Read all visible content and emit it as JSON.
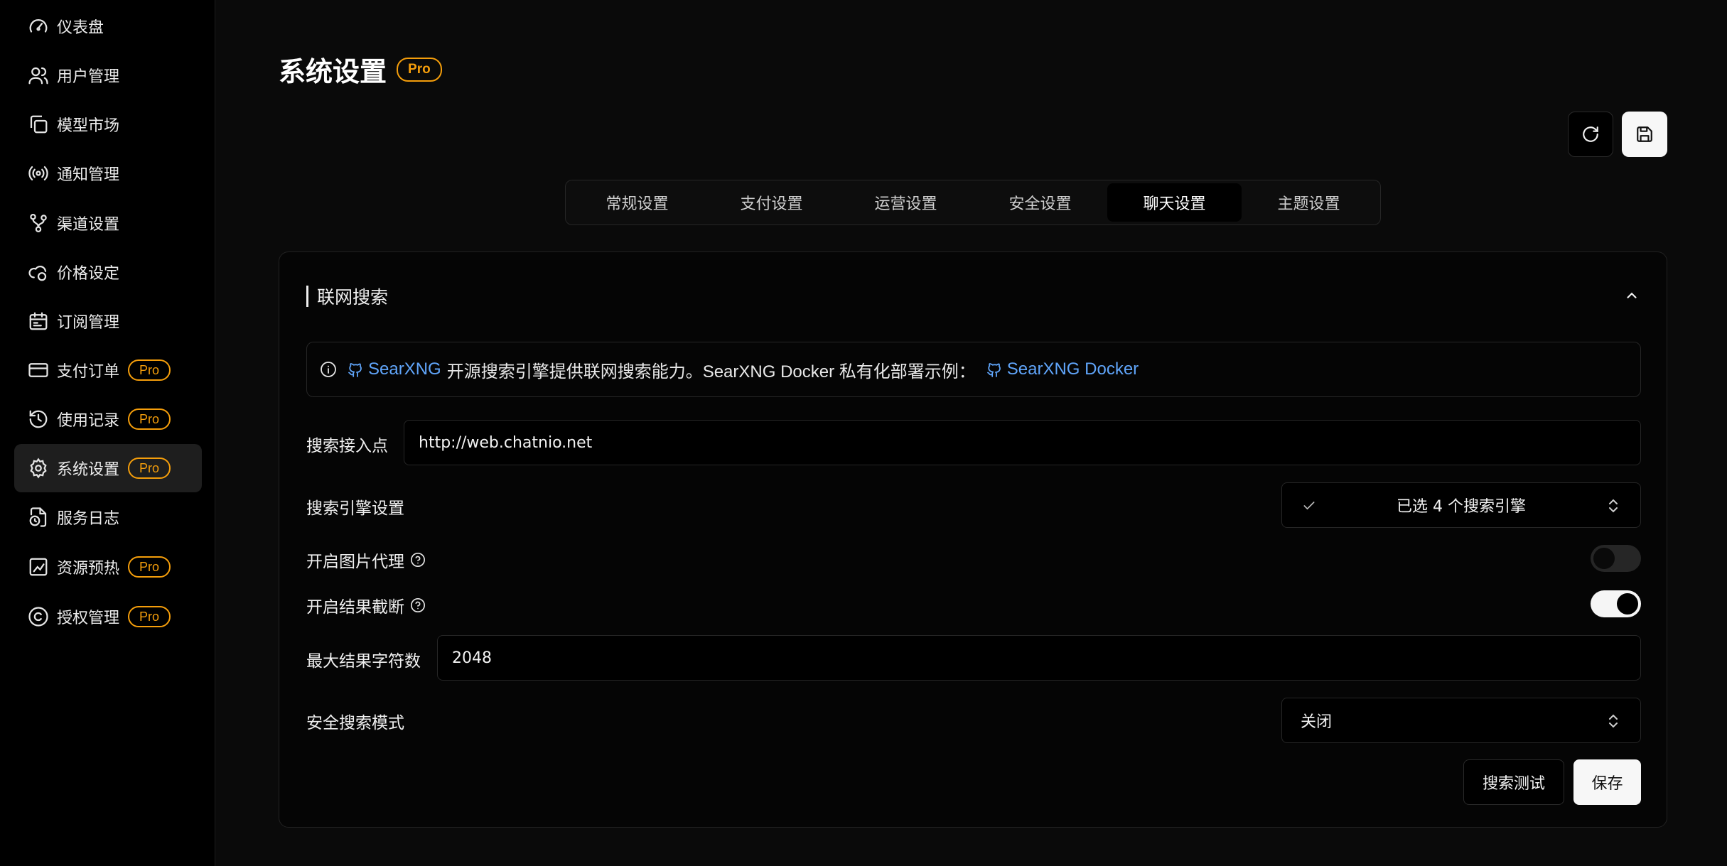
{
  "sidebar": {
    "items": [
      {
        "label": "仪表盘",
        "icon": "gauge-icon",
        "pro": ""
      },
      {
        "label": "用户管理",
        "icon": "users-icon",
        "pro": ""
      },
      {
        "label": "模型市场",
        "icon": "copy-icon",
        "pro": ""
      },
      {
        "label": "通知管理",
        "icon": "radio-icon",
        "pro": ""
      },
      {
        "label": "渠道设置",
        "icon": "git-branch-icon",
        "pro": ""
      },
      {
        "label": "价格设定",
        "icon": "cloud-coin-icon",
        "pro": ""
      },
      {
        "label": "订阅管理",
        "icon": "calendar-icon",
        "pro": ""
      },
      {
        "label": "支付订单",
        "icon": "credit-card-icon",
        "pro": "Pro"
      },
      {
        "label": "使用记录",
        "icon": "history-icon",
        "pro": "Pro"
      },
      {
        "label": "系统设置",
        "icon": "gear-icon",
        "pro": "Pro",
        "active": true
      },
      {
        "label": "服务日志",
        "icon": "file-clock-icon",
        "pro": ""
      },
      {
        "label": "资源预热",
        "icon": "zap-chart-icon",
        "pro": "Pro"
      },
      {
        "label": "授权管理",
        "icon": "copyright-icon",
        "pro": "Pro"
      }
    ]
  },
  "header": {
    "title": "系统设置",
    "badge": "Pro"
  },
  "tabs": [
    {
      "label": "常规设置"
    },
    {
      "label": "支付设置"
    },
    {
      "label": "运营设置"
    },
    {
      "label": "安全设置"
    },
    {
      "label": "聊天设置",
      "active": true
    },
    {
      "label": "主题设置"
    }
  ],
  "section": {
    "title": "联网搜索",
    "info": {
      "link1": "SearXNG",
      "text": "开源搜索引擎提供联网搜索能力。SearXNG Docker 私有化部署示例：",
      "link2": "SearXNG Docker"
    },
    "endpoint": {
      "label": "搜索接入点",
      "value": "http://web.chatnio.net"
    },
    "engines": {
      "label": "搜索引擎设置",
      "value": "已选 4 个搜索引擎"
    },
    "image_proxy": {
      "label": "开启图片代理",
      "enabled": false
    },
    "truncate": {
      "label": "开启结果截断",
      "enabled": true
    },
    "max_chars": {
      "label": "最大结果字符数",
      "value": "2048"
    },
    "safe_mode": {
      "label": "安全搜索模式",
      "value": "关闭"
    },
    "buttons": {
      "test": "搜索测试",
      "save": "保存"
    }
  },
  "colors": {
    "accent_pro": "#f59e0b",
    "link": "#60a5fa",
    "background": "#0a0a0a"
  }
}
